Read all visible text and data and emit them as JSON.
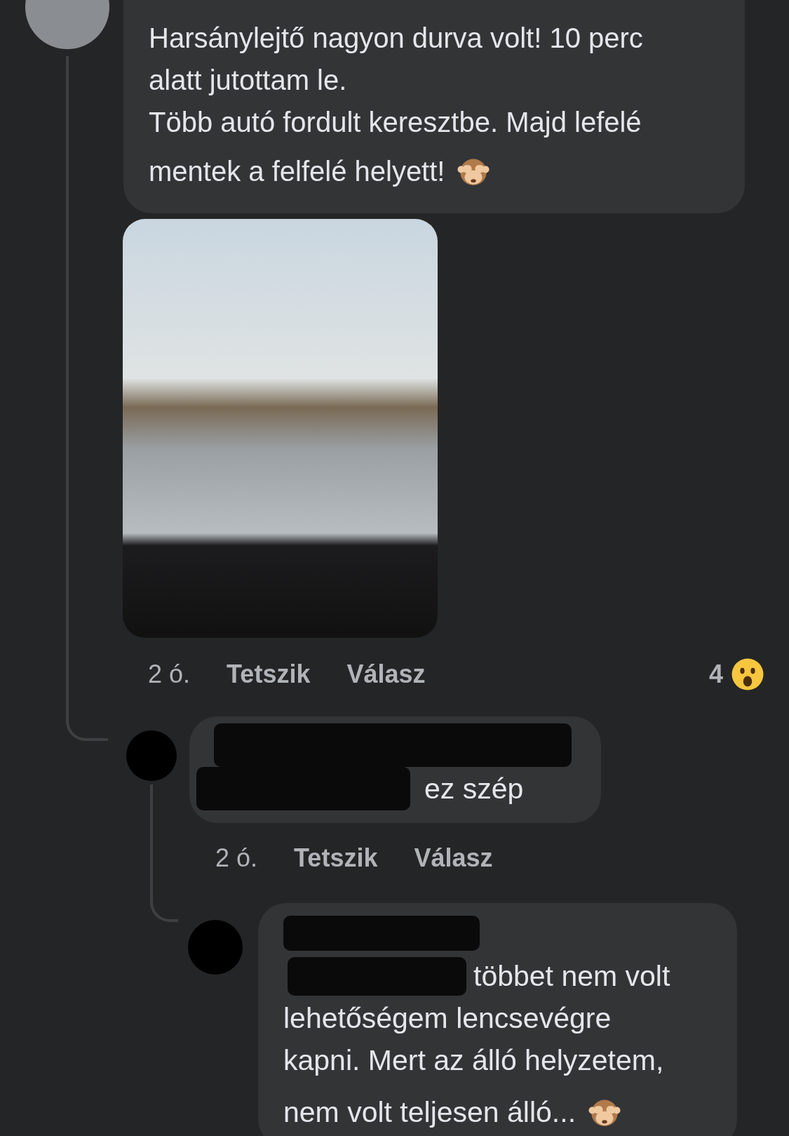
{
  "comments": [
    {
      "first_line_redacted": false,
      "lines": [
        "Harsánylejtő nagyon durva volt! 10 perc",
        "alatt jutottam le.",
        "Több autó fordult keresztbe. Majd lefelé",
        "mentek a felfelé helyett!"
      ],
      "ends_with_emoji": true,
      "photo": true,
      "time": "2 ó.",
      "like": "Tetszik",
      "reply": "Válasz",
      "reaction_count": "4"
    },
    {
      "first_line_redacted": true,
      "lines": [
        "ez szép"
      ],
      "ends_with_emoji": false,
      "photo": false,
      "time": "2 ó.",
      "like": "Tetszik",
      "reply": "Válasz"
    },
    {
      "first_line_redacted": true,
      "lines": [
        "többet nem volt",
        "lehetőségem lencsevégre",
        "kapni. Mert az álló helyzetem,",
        "nem volt teljesen álló..."
      ],
      "ends_with_emoji": true,
      "photo": false
    }
  ]
}
